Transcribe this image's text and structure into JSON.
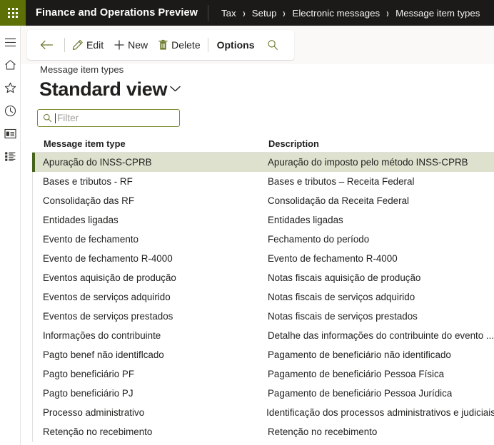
{
  "topbar": {
    "waffle_icon": "waffle-grid-icon",
    "app_title": "Finance and Operations Preview",
    "breadcrumb": [
      "Tax",
      "Setup",
      "Electronic messages",
      "Message item types"
    ],
    "separator": "›"
  },
  "rail": {
    "items": [
      {
        "icon": "hamburger-menu-icon",
        "name": "expand-navigation"
      },
      {
        "icon": "home-icon",
        "name": "home"
      },
      {
        "icon": "star-icon",
        "name": "favorites"
      },
      {
        "icon": "clock-icon",
        "name": "recent"
      },
      {
        "icon": "workspace-icon",
        "name": "workspaces"
      },
      {
        "icon": "list-icon",
        "name": "modules"
      }
    ]
  },
  "toolbar": {
    "back_icon": "back-arrow-icon",
    "edit_label": "Edit",
    "edit_icon": "pencil-icon",
    "new_label": "New",
    "new_icon": "plus-icon",
    "delete_label": "Delete",
    "delete_icon": "trash-icon",
    "options_label": "Options",
    "search_icon": "search-icon"
  },
  "page": {
    "caption": "Message item types",
    "view_title": "Standard view",
    "view_chevron_icon": "chevron-down-icon"
  },
  "filter": {
    "icon": "search-icon",
    "placeholder": "Filter",
    "value": ""
  },
  "grid": {
    "columns": [
      "Message item type",
      "Description"
    ],
    "selected_index": 0,
    "rows": [
      {
        "type": "Apuração do INSS-CPRB",
        "description": "Apuração do imposto pelo método INSS-CPRB"
      },
      {
        "type": "Bases e tributos - RF",
        "description": "Bases e tributos – Receita Federal"
      },
      {
        "type": "Consolidação das RF",
        "description": "Consolidação da Receita Federal"
      },
      {
        "type": "Entidades ligadas",
        "description": "Entidades ligadas"
      },
      {
        "type": "Evento de fechamento",
        "description": "Fechamento do período"
      },
      {
        "type": "Evento de fechamento R-4000",
        "description": "Evento de fechamento R-4000"
      },
      {
        "type": "Eventos aquisição de produção",
        "description": "Notas fiscais aquisição de produção"
      },
      {
        "type": "Eventos de serviços adquirido",
        "description": "Notas fiscais de serviços adquirido"
      },
      {
        "type": "Eventos de serviços prestados",
        "description": "Notas fiscais de serviços prestados"
      },
      {
        "type": "Informações do contribuinte",
        "description": "Detalhe das informações do contribuinte do evento ..."
      },
      {
        "type": "Pagto benef não identiflcado",
        "description": "Pagamento de beneficiário não identificado"
      },
      {
        "type": "Pagto beneficiário PF",
        "description": "Pagamento de beneficiário Pessoa Física"
      },
      {
        "type": "Pagto beneficiário PJ",
        "description": "Pagamento de beneficiário Pessoa Jurídica"
      },
      {
        "type": "Processo administrativo",
        "description": "Identificação dos processos administrativos e judiciais"
      },
      {
        "type": "Retenção no recebimento",
        "description": "Retenção no recebimento"
      }
    ]
  },
  "colors": {
    "brand_green": "#5c7006",
    "topbar_bg": "#1b1a19",
    "selected_row_bg": "#dde1cd",
    "selected_row_bar": "#47641d",
    "filter_border": "#7a8c2e"
  }
}
